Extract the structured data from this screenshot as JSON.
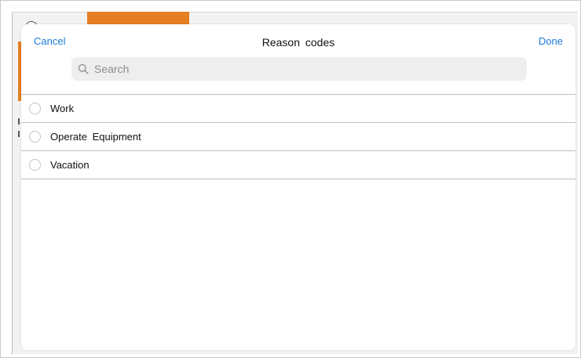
{
  "modal": {
    "cancel_label": "Cancel",
    "title": "Reason codes",
    "done_label": "Done"
  },
  "search": {
    "placeholder": "Search",
    "icon": "search-icon"
  },
  "reasons": [
    {
      "label": "Work",
      "selected": false
    },
    {
      "label": "Operate Equipment",
      "selected": false
    },
    {
      "label": "Vacation",
      "selected": false
    }
  ],
  "colors": {
    "accent": "#1b7ad6",
    "background_highlight": "#e67e22"
  }
}
